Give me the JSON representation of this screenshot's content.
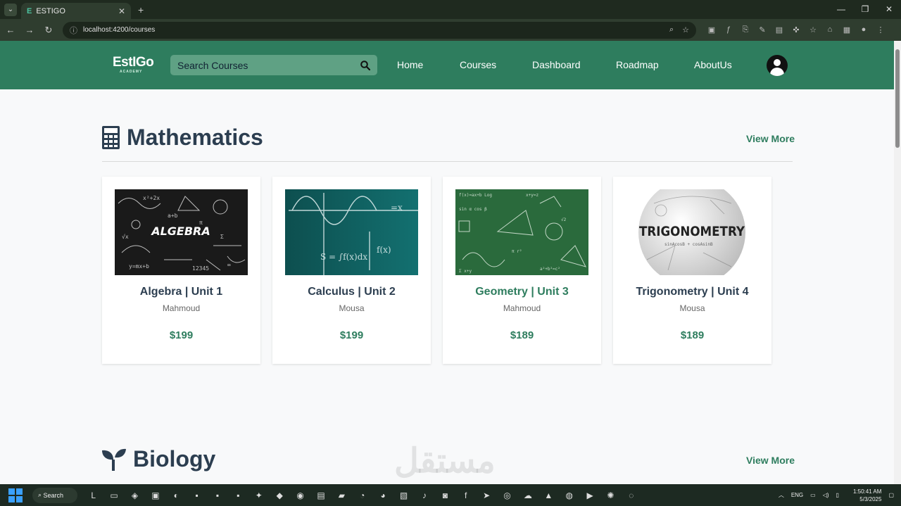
{
  "browser": {
    "tab_title": "ESTIGO",
    "url": "localhost:4200/courses"
  },
  "header": {
    "logo": "EstIGo",
    "logo_sub": "ACADEMY",
    "search_placeholder": "Search Courses",
    "nav": [
      "Home",
      "Courses",
      "Dashboard",
      "Roadmap",
      "AboutUs"
    ]
  },
  "sections": [
    {
      "title": "Mathematics",
      "view_more": "View More",
      "courses": [
        {
          "title": "Algebra | Unit 1",
          "author": "Mahmoud",
          "price": "$199",
          "thumb_text": "ALGEBRA"
        },
        {
          "title": "Calculus | Unit 2",
          "author": "Mousa",
          "price": "$199",
          "thumb_text": ""
        },
        {
          "title": "Geometry | Unit 3",
          "author": "Mahmoud",
          "price": "$189",
          "thumb_text": ""
        },
        {
          "title": "Trigonometry | Unit 4",
          "author": "Mousa",
          "price": "$189",
          "thumb_text": "TRIGONOMETRY"
        }
      ]
    },
    {
      "title": "Biology",
      "view_more": "View More"
    }
  ],
  "watermark": "مستقل",
  "taskbar": {
    "search_label": "Search",
    "lang": "ENG",
    "time": "1:50:41 AM",
    "date": "5/3/2025"
  },
  "colors": {
    "brand": "#2e7d5e",
    "heading": "#2c3e50",
    "highlighted_title": "#2e7d5e"
  }
}
